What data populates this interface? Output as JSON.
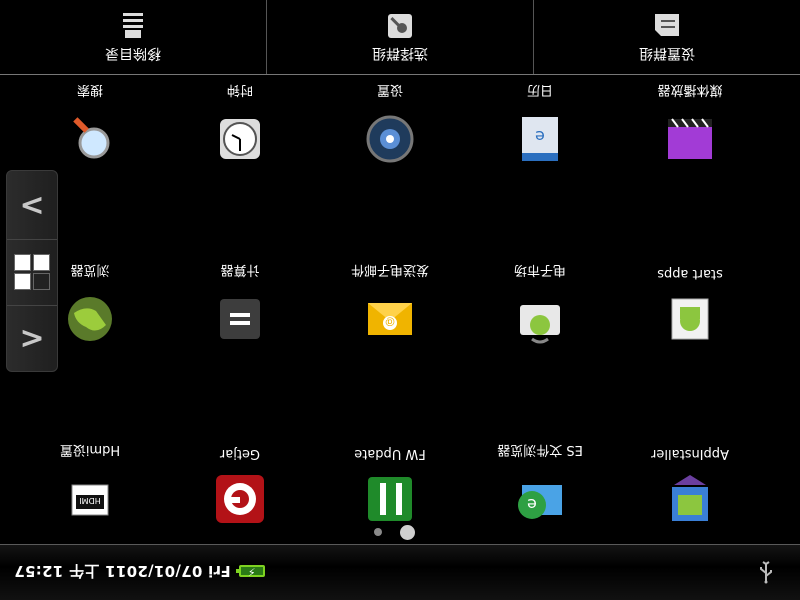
{
  "status_bar": {
    "clock": "Fri 07/01/2011 上午 12:57",
    "icons": [
      "usb-icon",
      "battery-charging-icon"
    ]
  },
  "pages": {
    "count": 2,
    "active": 1
  },
  "apps": [
    {
      "label": "AppInstaller",
      "icon": "appinstaller-icon"
    },
    {
      "label": "ES 文件浏览器",
      "icon": "es-file-explorer-icon"
    },
    {
      "label": "FW Update",
      "icon": "fw-update-icon"
    },
    {
      "label": "Getjar",
      "icon": "getjar-icon"
    },
    {
      "label": "Hdmi设置",
      "icon": "hdmi-icon"
    },
    {
      "label": "start apps",
      "icon": "android-box-icon"
    },
    {
      "label": "电子市场",
      "icon": "android-market-icon"
    },
    {
      "label": "发送电子邮件",
      "icon": "email-icon"
    },
    {
      "label": "计算器",
      "icon": "calculator-icon"
    },
    {
      "label": "浏览器",
      "icon": "browser-globe-icon"
    },
    {
      "label": "媒体播放器",
      "icon": "media-player-icon"
    },
    {
      "label": "日历",
      "icon": "calendar-icon"
    },
    {
      "label": "设置",
      "icon": "settings-icon"
    },
    {
      "label": "时钟",
      "icon": "clock-icon"
    },
    {
      "label": "搜索",
      "icon": "search-magnifier-icon"
    }
  ],
  "switcher": {
    "prev": "<",
    "next": ">",
    "icon": "grid-view-icon"
  },
  "toolbar": {
    "items": [
      {
        "label": "设置群组",
        "icon": "group-settings-icon"
      },
      {
        "label": "选择群组",
        "icon": "select-group-icon"
      },
      {
        "label": "移除目录",
        "icon": "remove-folder-icon"
      }
    ]
  },
  "colors": {
    "background": "#000000",
    "battery": "#7ed321"
  }
}
